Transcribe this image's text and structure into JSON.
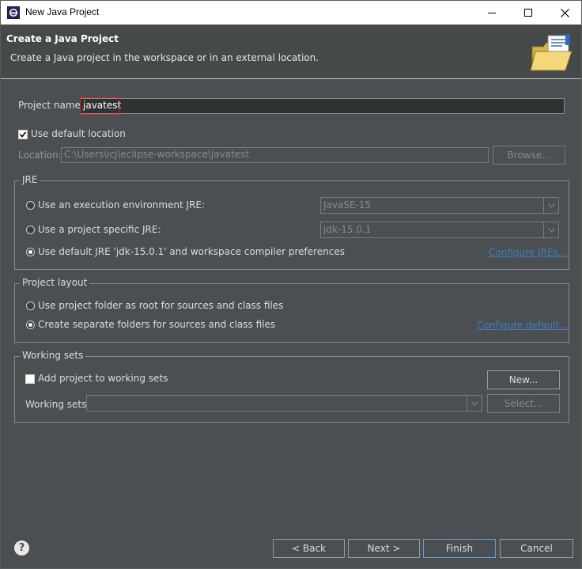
{
  "window": {
    "title": "New Java Project",
    "minimize_icon": "minimize-icon",
    "maximize_icon": "maximize-icon",
    "close_icon": "close-icon"
  },
  "header": {
    "title": "Create a Java Project",
    "description": "Create a Java project in the workspace or in an external location."
  },
  "project": {
    "name_label": "Project name:",
    "name_value": "javatest",
    "use_default_location_label": "Use default location",
    "use_default_location_checked": true,
    "location_label": "Location:",
    "location_value": "C:\\Users\\icj\\eclipse-workspace\\javatest",
    "browse_label": "Browse..."
  },
  "jre": {
    "group_title": "JRE",
    "option_env_label": "Use an execution environment JRE:",
    "option_env_value": "JavaSE-15",
    "option_specific_label": "Use a project specific JRE:",
    "option_specific_value": "jdk-15.0.1",
    "option_default_label": "Use default JRE 'jdk-15.0.1' and workspace compiler preferences",
    "configure_link": "Configure JREs...",
    "selected": "default"
  },
  "layout": {
    "group_title": "Project layout",
    "option_root_label": "Use project folder as root for sources and class files",
    "option_separate_label": "Create separate folders for sources and class files",
    "configure_link": "Configure default...",
    "selected": "separate"
  },
  "working_sets": {
    "group_title": "Working sets",
    "add_label": "Add project to working sets",
    "add_checked": false,
    "new_label": "New...",
    "sets_label": "Working sets:",
    "select_label": "Select..."
  },
  "footer": {
    "help_symbol": "?",
    "back_label": "< Back",
    "next_label": "Next >",
    "finish_label": "Finish",
    "cancel_label": "Cancel"
  }
}
